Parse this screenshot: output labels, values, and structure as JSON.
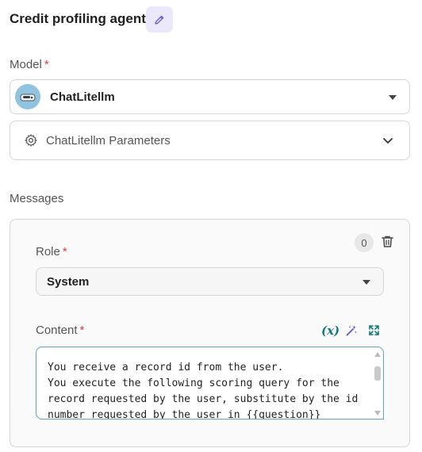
{
  "header": {
    "title": "Credit profiling agent",
    "edit_icon": "pencil-icon"
  },
  "model": {
    "label": "Model",
    "required_mark": "*",
    "value": "ChatLitellm",
    "avatar_icon": "robot-avatar-icon"
  },
  "params": {
    "label": "ChatLitellm Parameters",
    "icon": "gear-icon"
  },
  "messages": {
    "label": "Messages",
    "items": [
      {
        "index": "0",
        "role_label": "Role",
        "role_required_mark": "*",
        "role_value": "System",
        "content_label": "Content",
        "content_required_mark": "*",
        "variable_button": "(x)",
        "content_text": "You receive a record id from the user.\nYou execute the following scoring query for the record requested by the user, substitute by the id number requested by the user in {{question}}"
      }
    ]
  },
  "colors": {
    "accent": "#137a7f",
    "wand": "#6b4fd8",
    "required": "#e23b3b",
    "edit_bg": "#ece8fb"
  }
}
